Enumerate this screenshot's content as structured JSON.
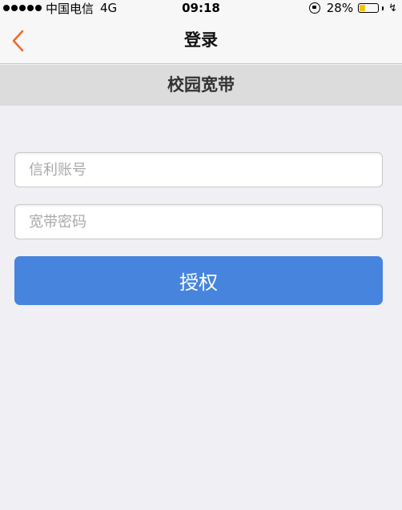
{
  "status_bar": {
    "carrier": "中国电信",
    "network": "4G",
    "time": "09:18",
    "battery_percent": "28%",
    "battery_level": 0.28,
    "signal_bars": 5
  },
  "nav": {
    "title": "登录",
    "back_icon": "chevron-left-icon"
  },
  "section": {
    "title": "校园宽带"
  },
  "form": {
    "account_placeholder": "信利账号",
    "account_value": "",
    "password_placeholder": "宽带密码",
    "password_value": "",
    "submit_label": "授权"
  },
  "colors": {
    "accent": "#f0682e",
    "button": "#4684de",
    "battery": "#f5c400"
  }
}
